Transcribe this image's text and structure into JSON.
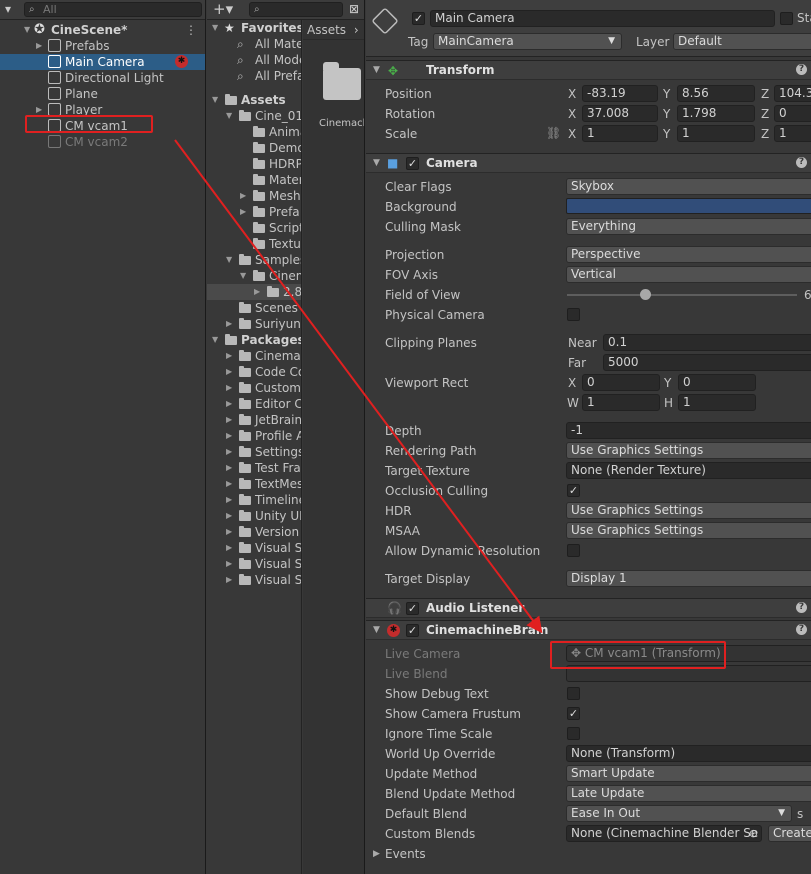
{
  "hierarchy": {
    "search_placeholder": "All",
    "scene_name": "CineScene*",
    "items": [
      {
        "label": "Prefabs"
      },
      {
        "label": "Main Camera"
      },
      {
        "label": "Directional Light"
      },
      {
        "label": "Plane"
      },
      {
        "label": "Player"
      },
      {
        "label": "CM vcam1"
      },
      {
        "label": "CM vcam2"
      }
    ]
  },
  "project": {
    "favorites_label": "Favorites",
    "favorites": [
      "All Mate",
      "All Mode",
      "All Prefa"
    ],
    "assets_label": "Assets",
    "breadcrumb": "Assets",
    "breadcrumb_sep": "›",
    "assets": [
      "Cine_01",
      "Anima",
      "Demo",
      "HDRP",
      "Mater",
      "Mesh",
      "Prefa",
      "Script",
      "Textu",
      "Samples",
      "Cinem",
      "2.8",
      "Scenes",
      "Suriyun"
    ],
    "packages_label": "Packages",
    "packages": [
      "Cinemac",
      "Code Co",
      "Custom",
      "Editor C",
      "JetBrain",
      "Profile A",
      "Settings",
      "Test Fra",
      "TextMes",
      "Timeline",
      "Unity UI",
      "Version",
      "Visual S",
      "Visual S",
      "Visual S"
    ],
    "grid_item": "Cinemach"
  },
  "inspector": {
    "object_name": "Main Camera",
    "static_label": "Sta",
    "tag_label": "Tag",
    "tag_value": "MainCamera",
    "layer_label": "Layer",
    "layer_value": "Default",
    "transform": {
      "title": "Transform",
      "position_label": "Position",
      "rotation_label": "Rotation",
      "scale_label": "Scale",
      "position": {
        "x": "-83.19",
        "y": "8.56",
        "z": "104.3"
      },
      "rotation": {
        "x": "37.008",
        "y": "1.798",
        "z": "0"
      },
      "scale": {
        "x": "1",
        "y": "1",
        "z": "1"
      }
    },
    "camera": {
      "title": "Camera",
      "rows": {
        "clear_flags": {
          "label": "Clear Flags",
          "value": "Skybox"
        },
        "background": {
          "label": "Background",
          "color": "#314d79"
        },
        "culling_mask": {
          "label": "Culling Mask",
          "value": "Everything"
        },
        "projection": {
          "label": "Projection",
          "value": "Perspective"
        },
        "fov_axis": {
          "label": "FOV Axis",
          "value": "Vertical"
        },
        "field_of_view": {
          "label": "Field of View",
          "value": "6"
        },
        "physical_camera": {
          "label": "Physical Camera"
        },
        "clipping_planes": {
          "label": "Clipping Planes",
          "near_label": "Near",
          "near": "0.1",
          "far_label": "Far",
          "far": "5000"
        },
        "viewport_rect": {
          "label": "Viewport Rect",
          "x": "0",
          "y": "0",
          "w": "1",
          "h": "1"
        },
        "depth": {
          "label": "Depth",
          "value": "-1"
        },
        "rendering_path": {
          "label": "Rendering Path",
          "value": "Use Graphics Settings"
        },
        "target_texture": {
          "label": "Target Texture",
          "value": "None (Render Texture)"
        },
        "occlusion_culling": {
          "label": "Occlusion Culling"
        },
        "hdr": {
          "label": "HDR",
          "value": "Use Graphics Settings"
        },
        "msaa": {
          "label": "MSAA",
          "value": "Use Graphics Settings"
        },
        "allow_dynamic_resolution": {
          "label": "Allow Dynamic Resolution"
        },
        "target_display": {
          "label": "Target Display",
          "value": "Display 1"
        }
      }
    },
    "audio_listener": {
      "title": "Audio Listener"
    },
    "brain": {
      "title": "CinemachineBrain",
      "live_camera_label": "Live Camera",
      "live_camera_value": "CM vcam1 (Transform)",
      "live_blend_label": "Live Blend",
      "show_debug_text": "Show Debug Text",
      "show_camera_frustum": "Show Camera Frustum",
      "ignore_time_scale": "Ignore Time Scale",
      "world_up_override_label": "World Up Override",
      "world_up_override_value": "None (Transform)",
      "update_method_label": "Update Method",
      "update_method_value": "Smart Update",
      "blend_update_method_label": "Blend Update Method",
      "blend_update_method_value": "Late Update",
      "default_blend_label": "Default Blend",
      "default_blend_value": "Ease In Out",
      "default_blend_unit": "s",
      "custom_blends_label": "Custom Blends",
      "custom_blends_value": "None (Cinemachine Blender Se",
      "create_label": "Create",
      "events_label": "Events"
    }
  },
  "colors": {
    "annotation": "#e02020",
    "selection": "#2c5d87"
  }
}
